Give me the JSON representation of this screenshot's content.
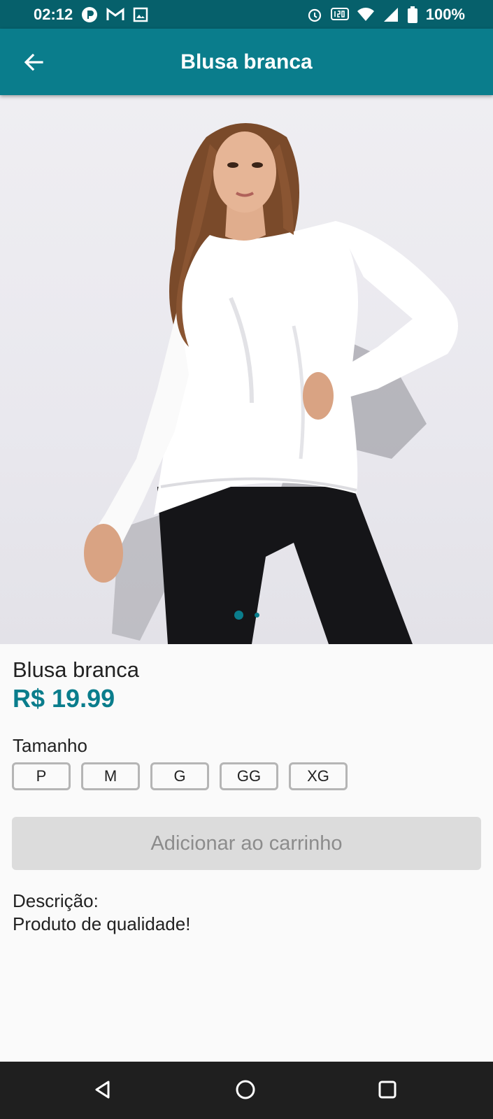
{
  "status_bar": {
    "time": "02:12",
    "battery": "100%",
    "icons": [
      "app-icon",
      "gmail-icon",
      "gallery-icon",
      "alarm-icon",
      "hz-120-icon",
      "wifi-icon",
      "signal-icon",
      "battery-icon"
    ]
  },
  "app_bar": {
    "title": "Blusa branca",
    "back_icon": "arrow-left-icon"
  },
  "carousel": {
    "image_subject": "photo",
    "pages": 2,
    "active_page": 1
  },
  "product": {
    "name": "Blusa branca",
    "price": "R$ 19.99",
    "size_label": "Tamanho",
    "sizes": [
      "P",
      "M",
      "G",
      "GG",
      "XG"
    ],
    "add_to_cart": "Adicionar ao carrinho",
    "description_label": "Descrição:",
    "description": "Produto de qualidade!"
  },
  "colors": {
    "primary": "#0a7d8c",
    "status_bar": "#06606b",
    "disabled_button": "#dcdcdc",
    "disabled_text": "#8c8c8c"
  },
  "nav_bar": {
    "icons": [
      "back-triangle-icon",
      "home-circle-icon",
      "recents-square-icon"
    ]
  }
}
